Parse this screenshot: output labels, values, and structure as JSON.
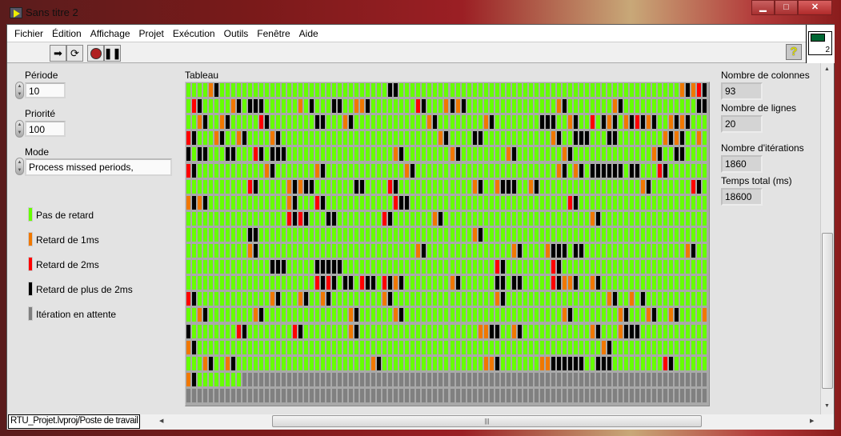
{
  "window": {
    "title": "Sans titre 2",
    "controls": [
      "minimize",
      "maximize",
      "close"
    ]
  },
  "menu": [
    "Fichier",
    "Édition",
    "Affichage",
    "Projet",
    "Exécution",
    "Outils",
    "Fenêtre",
    "Aide"
  ],
  "toolbar": {
    "buttons": [
      "run-icon",
      "run-continuously-icon",
      "abort-icon",
      "pause-icon"
    ],
    "help": "?",
    "vi_icon_number": "2"
  },
  "controls": {
    "periode": {
      "label": "Période",
      "value": "10"
    },
    "priorite": {
      "label": "Priorité",
      "value": "100"
    },
    "mode": {
      "label": "Mode",
      "value": "Process missed periods,"
    }
  },
  "legend": [
    {
      "label": "Pas de retard",
      "color": "#66ff00"
    },
    {
      "label": "Retard de 1ms",
      "color": "#f07800"
    },
    {
      "label": "Retard de 2ms",
      "color": "#ff0000"
    },
    {
      "label": "Retard de plus de 2ms",
      "color": "#000000"
    },
    {
      "label": "Itération en attente",
      "color": "#808080"
    }
  ],
  "table": {
    "label": "Tableau",
    "columns": 93,
    "rows_count": 20,
    "rows": [
      {
        "o": [
          4,
          88,
          90
        ],
        "r": [
          91
        ],
        "b": [
          5,
          36,
          37,
          89,
          92
        ],
        "p": []
      },
      {
        "o": [
          8,
          20,
          30,
          31,
          46,
          48,
          66,
          76
        ],
        "r": [
          1,
          41
        ],
        "b": [
          2,
          9,
          11,
          12,
          13,
          22,
          26,
          27,
          32,
          42,
          47,
          49,
          67,
          77,
          91,
          92
        ],
        "p": []
      },
      {
        "o": [
          2,
          6,
          28,
          43,
          53,
          68,
          75,
          78,
          82,
          86,
          88
        ],
        "r": [
          13,
          72,
          80
        ],
        "b": [
          3,
          7,
          14,
          23,
          24,
          29,
          44,
          54,
          63,
          64,
          65,
          69,
          74,
          76,
          79,
          81,
          83,
          87,
          89
        ],
        "p": []
      },
      {
        "o": [
          5,
          9,
          15,
          45,
          65,
          85,
          87,
          91
        ],
        "r": [
          0
        ],
        "b": [
          1,
          6,
          10,
          16,
          46,
          51,
          52,
          66,
          69,
          70,
          71,
          75,
          76,
          86,
          88
        ],
        "p": []
      },
      {
        "o": [
          37,
          47,
          57,
          67,
          83
        ],
        "r": [
          12
        ],
        "b": [
          0,
          2,
          3,
          7,
          8,
          13,
          15,
          16,
          17,
          38,
          48,
          58,
          68,
          84,
          87,
          88
        ],
        "p": []
      },
      {
        "o": [
          14,
          23,
          39,
          66,
          69
        ],
        "r": [
          0,
          84
        ],
        "b": [
          1,
          15,
          24,
          40,
          67,
          70,
          72,
          73,
          74,
          75,
          76,
          77,
          79,
          80,
          85
        ],
        "p": []
      },
      {
        "o": [
          18,
          20,
          51,
          55,
          61,
          81
        ],
        "r": [
          11,
          36,
          90
        ],
        "b": [
          12,
          19,
          21,
          22,
          30,
          31,
          37,
          52,
          56,
          57,
          58,
          62,
          82,
          91
        ],
        "p": []
      },
      {
        "o": [
          0,
          2,
          18
        ],
        "r": [
          23,
          37,
          68
        ],
        "b": [
          1,
          3,
          19,
          24,
          38,
          39,
          69
        ],
        "p": []
      },
      {
        "o": [
          44,
          72
        ],
        "r": [
          18,
          20,
          35
        ],
        "b": [
          19,
          21,
          25,
          26,
          36,
          45,
          73
        ],
        "p": []
      },
      {
        "o": [
          51
        ],
        "r": [],
        "b": [
          11,
          12,
          52
        ],
        "p": []
      },
      {
        "o": [
          11,
          41,
          58,
          64,
          89
        ],
        "r": [],
        "b": [
          12,
          42,
          59,
          65,
          66,
          67,
          69,
          70,
          90
        ],
        "p": []
      },
      {
        "o": [],
        "r": [
          55,
          65
        ],
        "b": [
          15,
          16,
          17,
          23,
          24,
          25,
          26,
          27,
          56,
          66
        ],
        "p": []
      },
      {
        "o": [
          37,
          47,
          67,
          68,
          72
        ],
        "r": [
          23,
          25,
          31,
          35,
          65
        ],
        "b": [
          24,
          26,
          28,
          29,
          32,
          33,
          36,
          38,
          48,
          55,
          56,
          58,
          59,
          66,
          69,
          73
        ],
        "p": []
      },
      {
        "o": [
          15,
          20,
          24,
          35,
          55,
          75,
          79
        ],
        "r": [
          0
        ],
        "b": [
          1,
          16,
          21,
          25,
          36,
          56,
          76,
          81
        ],
        "p": []
      },
      {
        "o": [
          2,
          12,
          29,
          37,
          67,
          77,
          82,
          86,
          92
        ],
        "r": [],
        "b": [
          3,
          13,
          30,
          38,
          68,
          78,
          83,
          87
        ],
        "p": []
      },
      {
        "o": [
          29,
          52,
          53,
          58,
          72,
          77
        ],
        "r": [
          9,
          19
        ],
        "b": [
          0,
          10,
          20,
          30,
          54,
          55,
          59,
          73,
          78,
          79,
          80
        ],
        "p": []
      },
      {
        "o": [
          0,
          74
        ],
        "r": [],
        "b": [
          1,
          75
        ],
        "p": []
      },
      {
        "o": [
          3,
          7,
          33,
          53,
          54,
          63,
          64
        ],
        "r": [
          85
        ],
        "b": [
          4,
          8,
          34,
          55,
          65,
          66,
          67,
          68,
          69,
          70,
          73,
          74,
          75,
          86
        ],
        "p": []
      },
      {
        "o": [
          0
        ],
        "r": [],
        "b": [
          1
        ],
        "p": [
          [
            10,
            92
          ]
        ]
      },
      {
        "o": [],
        "r": [],
        "b": [],
        "p": [
          [
            0,
            92
          ]
        ]
      }
    ]
  },
  "indicators": {
    "colonnes": {
      "label": "Nombre de colonnes",
      "value": "93"
    },
    "lignes": {
      "label": "Nombre de lignes",
      "value": "20"
    },
    "iterations": {
      "label": "Nombre d'itérations",
      "value": "1860"
    },
    "temps": {
      "label": "Temps total (ms)",
      "value": "18600"
    }
  },
  "statusbar": {
    "project": "RTU_Projet.lvproj/Poste de travail"
  }
}
